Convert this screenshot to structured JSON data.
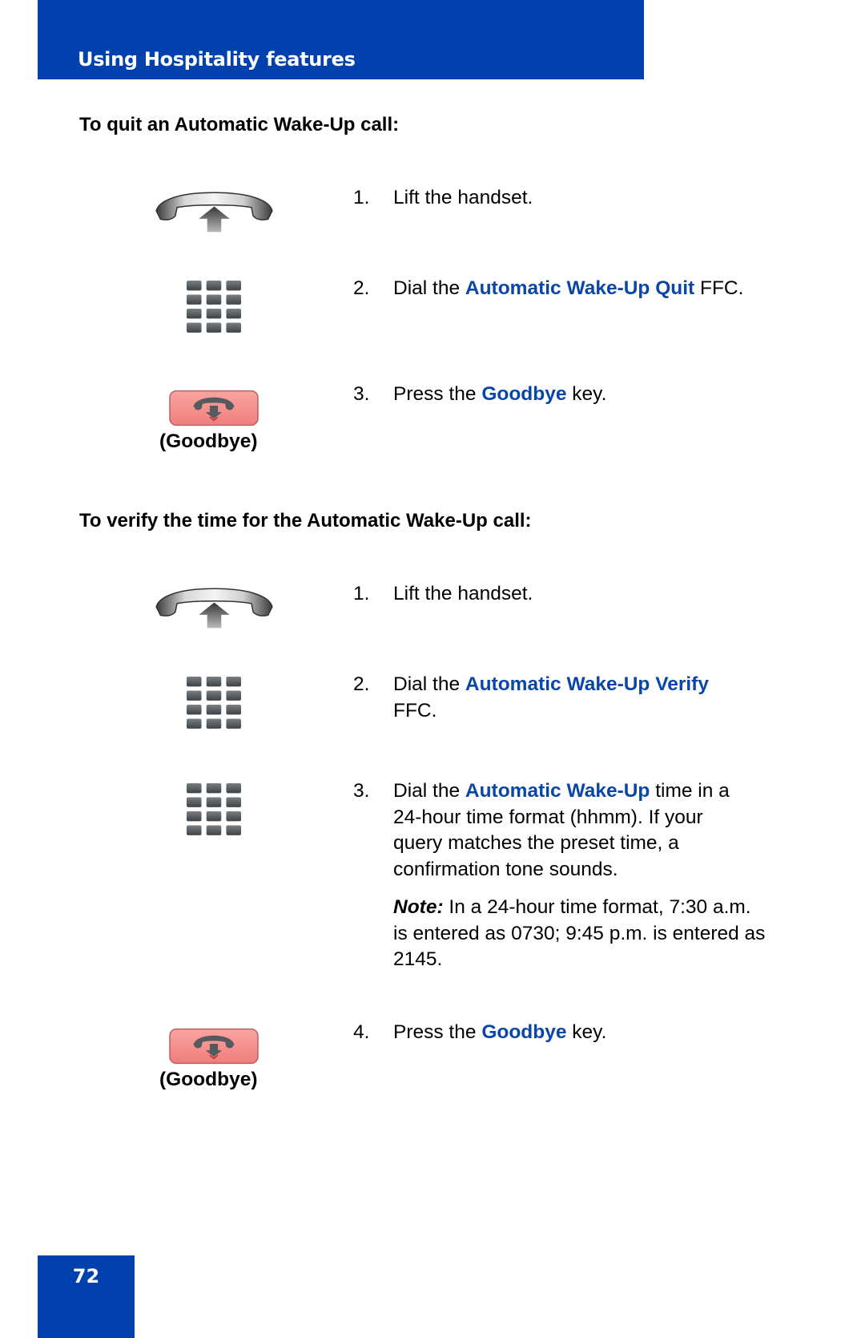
{
  "header": {
    "title": "Using Hospitality features"
  },
  "sections": [
    {
      "heading": "To quit an Automatic Wake-Up call:",
      "steps": [
        {
          "num": "1.",
          "pre": "Lift the handset.",
          "hl": "",
          "post": ""
        },
        {
          "num": "2.",
          "pre": "Dial the ",
          "hl": "Automatic Wake-Up Quit",
          "post": " FFC."
        },
        {
          "num": "3.",
          "pre": "Press the ",
          "hl": "Goodbye",
          "post": " key."
        }
      ],
      "icons": [
        "handset-lift-icon",
        "dialpad-icon",
        "goodbye-key-icon"
      ],
      "goodbye_caption": "(Goodbye)"
    },
    {
      "heading": "To verify the time for the Automatic Wake-Up call:",
      "steps": [
        {
          "num": "1.",
          "pre": "Lift the handset.",
          "hl": "",
          "post": ""
        },
        {
          "num": "2.",
          "pre": "Dial the ",
          "hl": "Automatic Wake-Up Verify",
          "post": " FFC."
        },
        {
          "num": "3.",
          "pre": "Dial the ",
          "hl": "Automatic Wake-Up",
          "post": " time in a 24-hour time format (hhmm). If your query matches the preset time, a confirmation tone sounds."
        },
        {
          "num": "4.",
          "pre": "Press the ",
          "hl": "Goodbye",
          "post": " key."
        }
      ],
      "note": {
        "label": "Note:",
        "text": " In a 24-hour time format, 7:30 a.m. is entered as 0730; 9:45 p.m. is entered as 2145."
      },
      "icons": [
        "handset-lift-icon",
        "dialpad-icon",
        "dialpad-icon",
        "goodbye-key-icon"
      ],
      "goodbye_caption": "(Goodbye)"
    }
  ],
  "footer": {
    "page_number": "72"
  },
  "colors": {
    "brand_blue": "#0041ad",
    "highlight_blue": "#0a46a8",
    "goodbye_key": "#f58f8c"
  }
}
